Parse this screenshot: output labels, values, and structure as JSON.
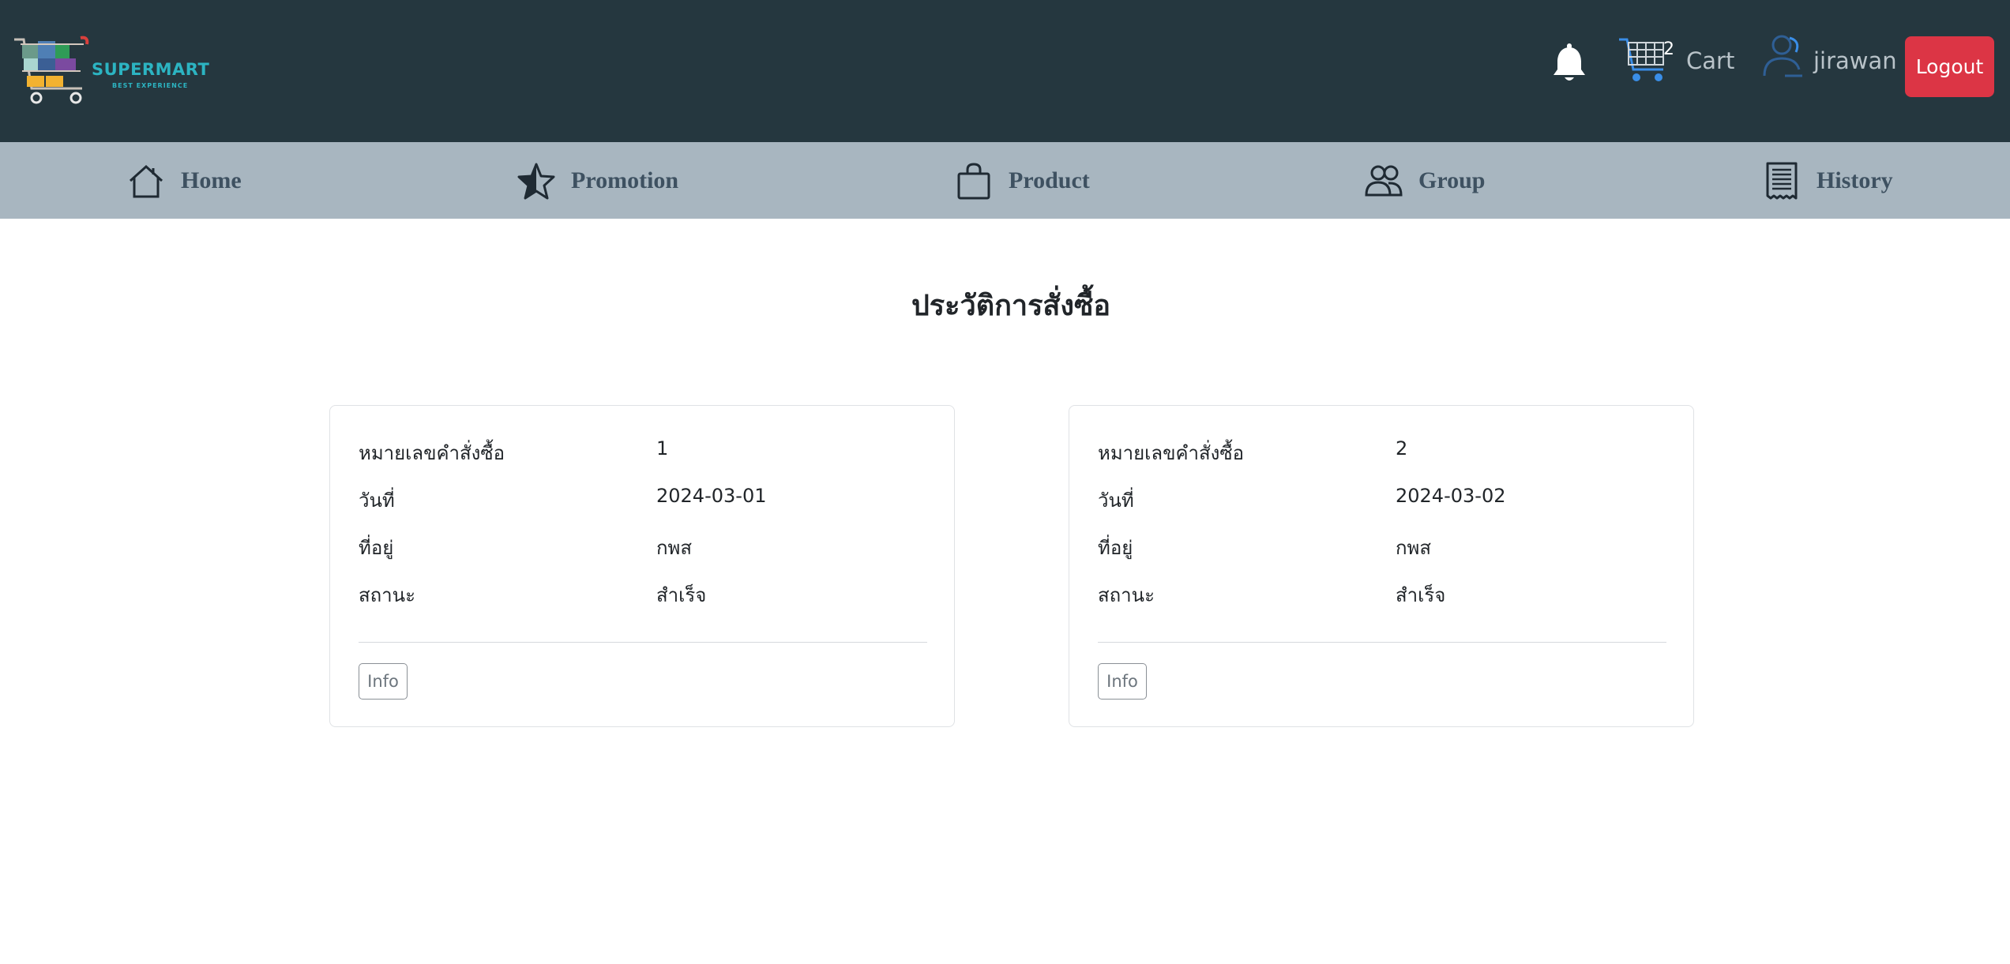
{
  "brand": {
    "name": "SUPERMART",
    "tagline": "BEST EXPERIENCE",
    "accent": "#2cb4c2",
    "logo_icon": "shopping-cart-logo-icon"
  },
  "header": {
    "bell_icon": "bell-icon",
    "cart_icon": "shopping-cart-icon",
    "cart_count": "2",
    "cart_label": "Cart",
    "user_icon": "user-outline-icon",
    "username": "jirawan",
    "logout_label": "Logout",
    "logout_color": "#dc3545",
    "background": "#25373f"
  },
  "nav": {
    "background": "#a8b6c0",
    "items": [
      {
        "label": "Home",
        "icon": "house-icon"
      },
      {
        "label": "Promotion",
        "icon": "star-icon"
      },
      {
        "label": "Product",
        "icon": "shopping-bag-icon"
      },
      {
        "label": "Group",
        "icon": "people-icon"
      },
      {
        "label": "History",
        "icon": "receipt-icon"
      }
    ]
  },
  "main": {
    "title": "ประวัติการสั่งซื้อ",
    "orders": [
      {
        "order_no_label": "หมายเลขคำสั่งซื้อ",
        "order_no": "1",
        "date_label": "วันที่",
        "date": "2024-03-01",
        "address_label": "ที่อยู่",
        "address": "กพส",
        "status_label": "สถานะ",
        "status": "สำเร็จ",
        "info_label": "Info"
      },
      {
        "order_no_label": "หมายเลขคำสั่งซื้อ",
        "order_no": "2",
        "date_label": "วันที่",
        "date": "2024-03-02",
        "address_label": "ที่อยู่",
        "address": "กพส",
        "status_label": "สถานะ",
        "status": "สำเร็จ",
        "info_label": "Info"
      }
    ]
  }
}
